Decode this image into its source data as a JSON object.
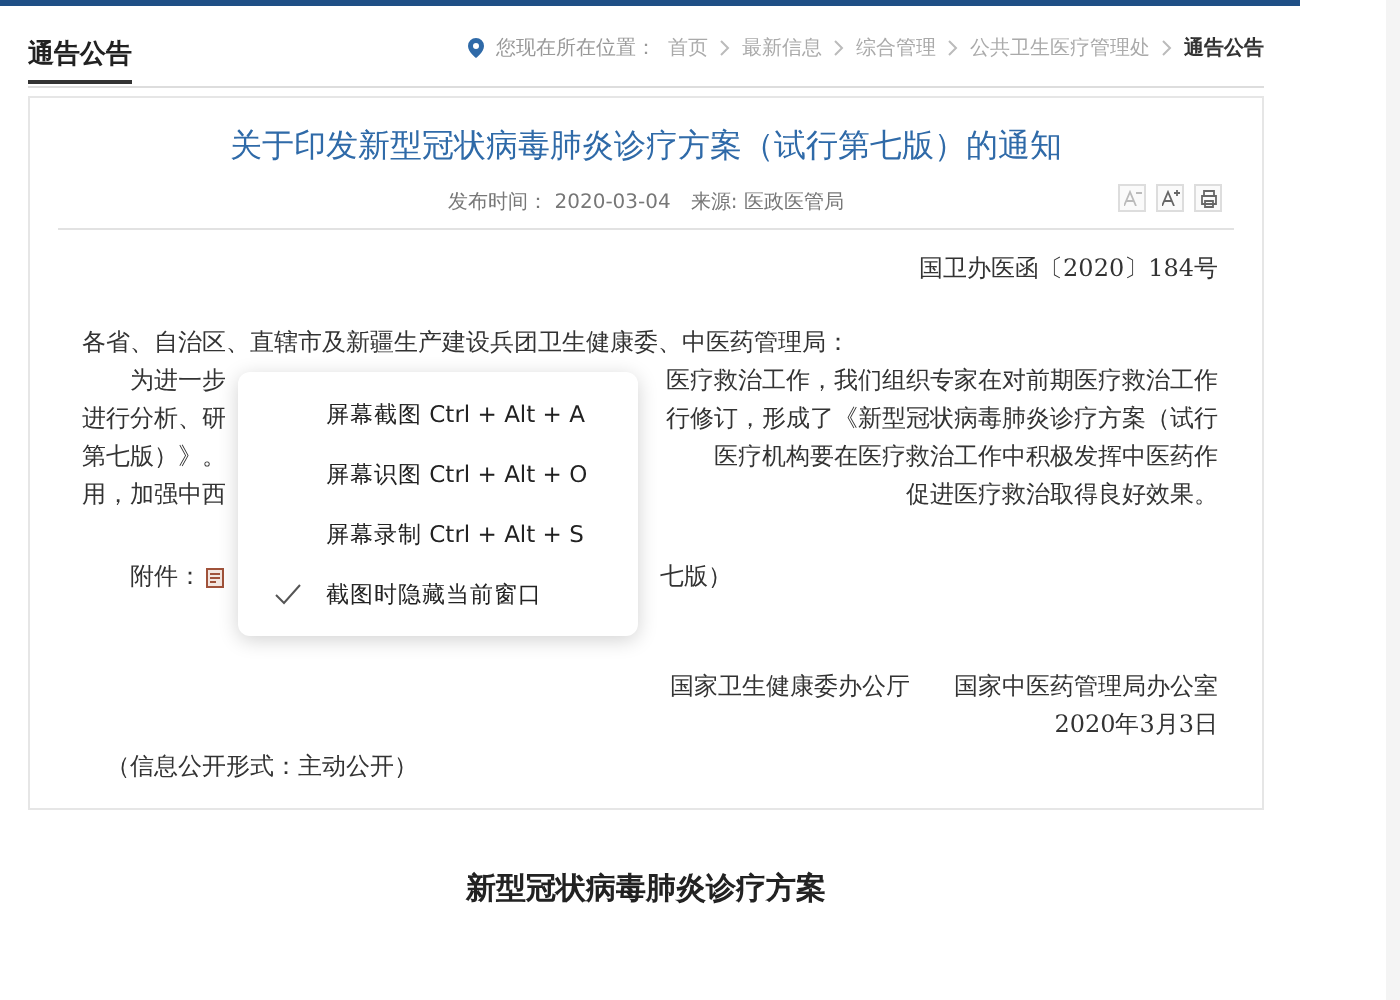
{
  "header": {
    "title": "通告公告",
    "location_label": "您现在所在位置：",
    "breadcrumb": [
      {
        "label": "首页",
        "current": false
      },
      {
        "label": "最新信息",
        "current": false
      },
      {
        "label": "综合管理",
        "current": false
      },
      {
        "label": "公共卫生医疗管理处",
        "current": false
      },
      {
        "label": "通告公告",
        "current": true
      }
    ]
  },
  "article": {
    "title": "关于印发新型冠状病毒肺炎诊疗方案（试行第七版）的通知",
    "meta": [
      "发布时间： 2020-03-04",
      "来源: 医政医管局"
    ],
    "doc_number": "国卫办医函〔2020〕184号",
    "salutation": "各省、自治区、直辖市及新疆生产建设兵团卫生健康委、中医药管理局：",
    "lines": [
      {
        "left": "为进一步",
        "right": "医疗救治工作，我们组织专家在对前期医疗救治工作",
        "indent": true
      },
      {
        "left": "进行分析、研",
        "right": "行修订，形成了《新型冠状病毒肺炎诊疗方案（试行",
        "indent": false
      },
      {
        "left": "第七版）》。",
        "right": "医疗机构要在医疗救治工作中积极发挥中医药作",
        "indent": false
      },
      {
        "left": "用，加强中西",
        "right": "促进医疗救治取得良好效果。",
        "indent": false
      }
    ],
    "attachment": {
      "label": "附件：",
      "tail": "七版）"
    },
    "signature": [
      "国家卫生健康委办公厅",
      "国家中医药管理局办公室"
    ],
    "date": "2020年3月3日",
    "disclosure": "（信息公开形式：主动公开）"
  },
  "menu": {
    "items": [
      {
        "label": "屏幕截图 Ctrl + Alt + A",
        "checked": false
      },
      {
        "label": "屏幕识图 Ctrl + Alt + O",
        "checked": false
      },
      {
        "label": "屏幕录制 Ctrl + Alt + S",
        "checked": false
      },
      {
        "label": "截图时隐藏当前窗口",
        "checked": true
      }
    ]
  },
  "document_heading": "新型冠状病毒肺炎诊疗方案"
}
